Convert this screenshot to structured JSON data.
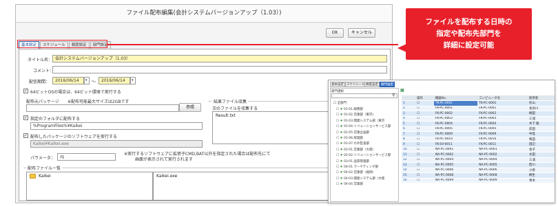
{
  "dialog": {
    "title": "ファイル配布編集(会計システムバージョンアップ（1.03）)",
    "ok_label": "OK",
    "cancel_label": "キャンセル",
    "tabs": [
      {
        "label": "基本設定",
        "active": true
      },
      {
        "label": "スケジュール",
        "active": false
      },
      {
        "label": "頻度設定",
        "active": false
      },
      {
        "label": "部門設定",
        "active": false
      }
    ],
    "title_label": "タイトル名：",
    "title_value": "会計システムバージョンアップ（1.03）",
    "comment_label": "コメント：",
    "comment_value": "",
    "period_label": "配信期間：",
    "period_from": "2016/06/14",
    "period_sep": "～",
    "period_to": "2016/06/14",
    "os64_label": "64ビットOSの場合は、64ビット環境で実行する",
    "os64_checked": true,
    "package_label": "配布元パッケージ",
    "package_note": "※配布可能最大サイズは2GBです",
    "package_value": "",
    "browse_label": "参照",
    "specified_folder_label": "指定のフォルダに配布する",
    "specified_folder_checked": true,
    "specified_folder_value": "%ProgramFiles%¥Kaikei",
    "run_label": "配布したパッケージのソフトウェアを実行する",
    "run_checked": true,
    "run_value": "Kaikei¥Kaikei.exe",
    "param_label": "パラメータ：",
    "param_value": "/q",
    "param_note_1": "※実行するソフトウェアに拡張子CMD,BAT以外を指定された場合は配布先にて",
    "param_note_2": "画面が表示されて実行されます",
    "result_group_label": "結果ファイル収集",
    "result_sub_label": "次のファイルを収集する",
    "result_file": "Result.txt",
    "distfile_group_label": "配布ファイル一覧",
    "distfile_folder": "Kaikei",
    "distfile_file": "Kaikei.exe"
  },
  "callout": {
    "line1": "ファイルを配布する日時の",
    "line2": "指定や配布先部門を",
    "line3": "詳細に設定可能",
    "color": "#e8202a"
  },
  "dept_window": {
    "tabs": [
      "基本設定",
      "スケジュール",
      "頻度設定",
      "部門設定"
    ],
    "search_label": "部門選択",
    "root": "全部門",
    "tree": [
      "01-01.総務部",
      "01-02.営業部（東京）",
      "01-03.開発システム部（東京",
      "01-04.ソリューションサービス部",
      "01-05.営業企画部",
      "01-06.経理部",
      "01-07.ホ外監査部",
      "02-01.営業部（大阪）",
      "02-02.ソリューションサービス部",
      "03-01.品質管理部",
      "04-01.マーケティング部",
      "04-02.営業部（福岡）",
      "04-03.開発システム部（大阪",
      "04-04.営業部"
    ],
    "table_headers": [
      "",
      "操作",
      "機器No.",
      "コンピュータ名",
      "使用者"
    ],
    "rows": [
      [
        "1",
        "",
        "TK-PC-0001",
        "TK-PC-0001",
        "杉山"
      ],
      [
        "2",
        "",
        "FK-PC-0001",
        "FK-PC-0001",
        "長谷川"
      ],
      [
        "3",
        "",
        "FK-PC-0002",
        "FK-PC-0002",
        "桐田"
      ],
      [
        "4",
        "",
        "FK-PC-0003",
        "FK-PC-0003",
        "三浦"
      ],
      [
        "5",
        "",
        "FK-PC-0004",
        "FK-PC-0004",
        "木下 聡"
      ],
      [
        "6",
        "",
        "FK-PC-0005",
        "FK-PC-0005",
        "前田"
      ],
      [
        "7",
        "",
        "FK-PC-0009",
        "FK-PC-0009",
        "中島"
      ],
      [
        "8",
        "",
        "FK-PC-0010",
        "FK-PC-0010",
        "和田"
      ],
      [
        "9",
        "",
        "FK-SV-0011",
        "FK-PC-0011",
        "田辺"
      ],
      [
        "10",
        "",
        "NA-PC-0001",
        "NA-PC-0001",
        "金子"
      ],
      [
        "11",
        "",
        "NA-PC-0002",
        "NA-PC-0002",
        "太田"
      ],
      [
        "12",
        "",
        "NA-PC-0004",
        "NA-PC-0004",
        "三浦"
      ],
      [
        "13",
        "",
        "NA-PC-0005",
        "NA-PC-0005",
        "西川"
      ],
      [
        "14",
        "",
        "NA-PC-0006",
        "NA-PC-0006",
        "小原"
      ],
      [
        "15",
        "",
        "NA-PC-0008",
        "NA-PC-0008",
        "桐生"
      ],
      [
        "16",
        "",
        "NA-PC-0009",
        "NA-PC-0009",
        "青木"
      ]
    ]
  }
}
